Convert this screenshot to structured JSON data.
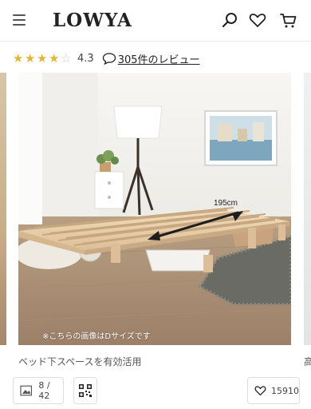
{
  "header": {
    "logo": "LOWYA",
    "icons": [
      "menu-icon",
      "search-icon",
      "heart-icon",
      "cart-icon"
    ]
  },
  "rating": {
    "stars": 4.3,
    "value_text": "4.3",
    "review_link": "305件のレビュー",
    "star_color": "#e0b63a"
  },
  "gallery": {
    "photo_note": "※こちらの画像はDサイズです",
    "dimension_label": "195cm",
    "caption": "ベッド下スペースを有効活用",
    "next_caption": "高"
  },
  "footer": {
    "image_counter": "8 / 42",
    "favorite_count": "15910"
  }
}
